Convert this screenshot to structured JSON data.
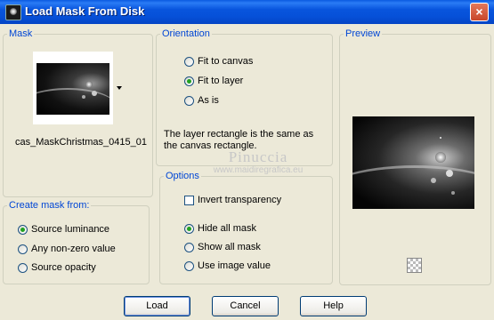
{
  "window": {
    "title": "Load Mask From Disk",
    "close_label": "×"
  },
  "mask": {
    "legend": "Mask",
    "filename": "cas_MaskChristmas_0415_01"
  },
  "orientation": {
    "legend": "Orientation",
    "options": [
      "Fit to canvas",
      "Fit to layer",
      "As is"
    ],
    "selected": "Fit to layer",
    "description": "The layer rectangle is the same as the canvas rectangle."
  },
  "preview": {
    "legend": "Preview"
  },
  "create_mask": {
    "legend": "Create mask from:",
    "options": [
      "Source luminance",
      "Any non-zero value",
      "Source opacity"
    ],
    "selected": "Source luminance"
  },
  "options": {
    "legend": "Options",
    "invert_label": "Invert transparency",
    "invert_checked": false,
    "mask_options": [
      "Hide all mask",
      "Show all mask",
      "Use image value"
    ],
    "selected": "Hide all mask"
  },
  "buttons": {
    "load": "Load",
    "cancel": "Cancel",
    "help": "Help"
  },
  "watermark": {
    "line1": "Pinuccia",
    "line2": "www.maidiregrafica.eu"
  }
}
